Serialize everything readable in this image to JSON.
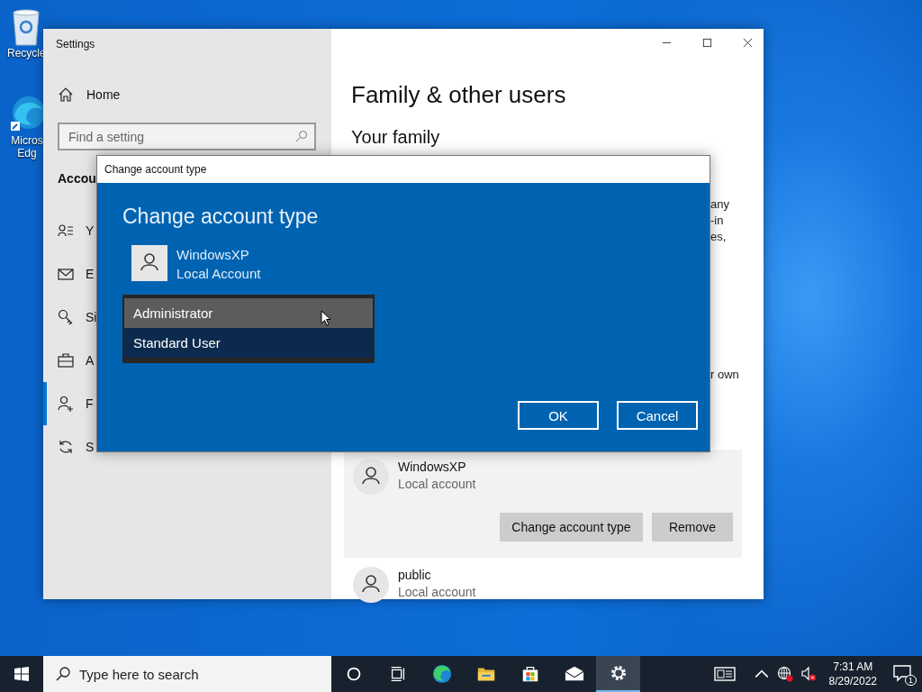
{
  "desktop_icons": [
    {
      "kind": "recycle-bin",
      "lines": [
        "Recycle"
      ]
    },
    {
      "kind": "browser",
      "lines": [
        "Micros",
        "Edg"
      ]
    }
  ],
  "settings_window": {
    "title": "Settings",
    "home": "Home",
    "search": {
      "placeholder": "Find a setting"
    },
    "section": "Accou",
    "nav_items": [
      {
        "kind": "person-list",
        "label": "Y",
        "selected": false
      },
      {
        "kind": "mail",
        "label": "E",
        "selected": false
      },
      {
        "kind": "key",
        "label": "Si",
        "selected": false
      },
      {
        "kind": "briefcase",
        "label": "A",
        "selected": false
      },
      {
        "kind": "person-add",
        "label": "F",
        "selected": true
      },
      {
        "kind": "sync",
        "label": "S",
        "selected": false
      }
    ],
    "heading": "Family & other users",
    "subheading": "Your family",
    "text_fragments": [
      "any",
      "-in",
      "es,"
    ],
    "text_fragment_2": "r own",
    "accounts": [
      {
        "name": "WindowsXP",
        "type": "Local account",
        "expanded": true,
        "buttons": [
          "Change account type",
          "Remove"
        ]
      },
      {
        "name": "public",
        "type": "Local account",
        "expanded": false
      }
    ]
  },
  "dialog": {
    "title": "Change account type",
    "heading": "Change account type",
    "account": {
      "name": "WindowsXP",
      "type": "Local Account"
    },
    "options": [
      {
        "label": "Administrator",
        "selected": true
      },
      {
        "label": "Standard User",
        "selected": false
      }
    ],
    "buttons": [
      "OK",
      "Cancel"
    ]
  },
  "taskbar": {
    "search": {
      "placeholder": "Type here to search"
    },
    "apps": [
      {
        "kind": "cortana",
        "selected": false
      },
      {
        "kind": "task-view",
        "selected": false
      },
      {
        "kind": "browser",
        "selected": false
      },
      {
        "kind": "folder",
        "selected": false
      },
      {
        "kind": "store",
        "selected": false
      },
      {
        "kind": "mail",
        "selected": false
      },
      {
        "kind": "settings",
        "selected": true
      }
    ],
    "time": "7:31 AM",
    "date": "8/29/2022",
    "notification_count": "1"
  }
}
